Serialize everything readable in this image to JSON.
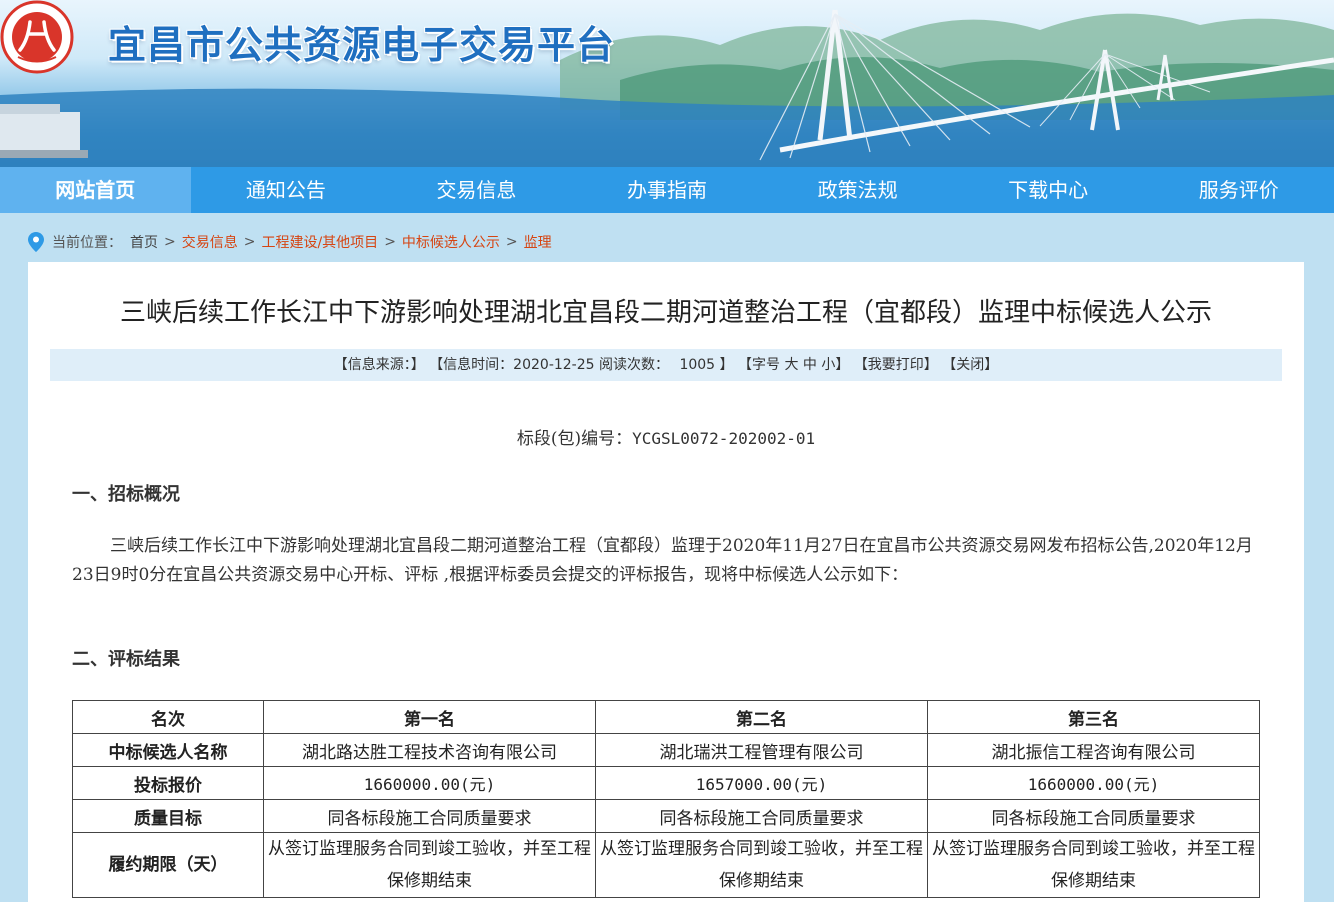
{
  "header": {
    "site_title": "宜昌市公共资源电子交易平台",
    "logo_icon": "red-seal-logo-icon",
    "logo_char": "八",
    "colors": {
      "title": "#1f6fc0",
      "logo": "#d9352a"
    }
  },
  "nav": {
    "items": [
      {
        "label": "网站首页",
        "active": true
      },
      {
        "label": "通知公告"
      },
      {
        "label": "交易信息"
      },
      {
        "label": "办事指南"
      },
      {
        "label": "政策法规"
      },
      {
        "label": "下载中心"
      },
      {
        "label": "服务评价"
      }
    ],
    "colors": {
      "bar": "#2e9ae6",
      "active": "#5fb2ef"
    }
  },
  "breadcrumb": {
    "prefix": "当前位置：",
    "sep": ">",
    "items": [
      "首页",
      "交易信息",
      "工程建设/其他项目",
      "中标候选人公示",
      "监理"
    ]
  },
  "article": {
    "title": "三峡后续工作长江中下游影响处理湖北宜昌段二期河道整治工程（宜都段）监理中标候选人公示",
    "info": {
      "source": "【信息来源：",
      "source_close": "】",
      "time": "【信息时间：2020-12-25 阅读次数：",
      "views": "1005",
      "time_close": "】",
      "font_label": "【字号",
      "font_large": "大",
      "font_medium": "中",
      "font_small": "小】",
      "print": "【我要打印】",
      "close": "【关闭】"
    },
    "section_label": "标段(包)编号：",
    "section_code": "YCGSL0072-202002-01",
    "h1": "一、招标概况",
    "paragraph": "三峡后续工作长江中下游影响处理湖北宜昌段二期河道整治工程（宜都段）监理于2020年11月27日在宜昌市公共资源交易网发布招标公告,2020年12月23日9时0分在宜昌公共资源交易中心开标、评标 ,根据评标委员会提交的评标报告，现将中标候选人公示如下：",
    "h2": "二、评标结果"
  },
  "table": {
    "header": [
      "名次",
      "第一名",
      "第二名",
      "第三名"
    ],
    "rows": [
      {
        "label": "中标候选人名称",
        "cells": [
          "湖北路达胜工程技术咨询有限公司",
          "湖北瑞洪工程管理有限公司",
          "湖北振信工程咨询有限公司"
        ]
      },
      {
        "label": "投标报价",
        "cells": [
          "1660000.00(元)",
          "1657000.00(元)",
          "1660000.00(元)"
        ]
      },
      {
        "label": "质量目标",
        "cells": [
          "同各标段施工合同质量要求",
          "同各标段施工合同质量要求",
          "同各标段施工合同质量要求"
        ]
      },
      {
        "label": "履约期限（天）",
        "cells": [
          "从签订监理服务合同到竣工验收，并至工程保修期结束",
          "从签订监理服务合同到竣工验收，并至工程保修期结束",
          "从签订监理服务合同到竣工验收，并至工程保修期结束"
        ]
      }
    ]
  }
}
